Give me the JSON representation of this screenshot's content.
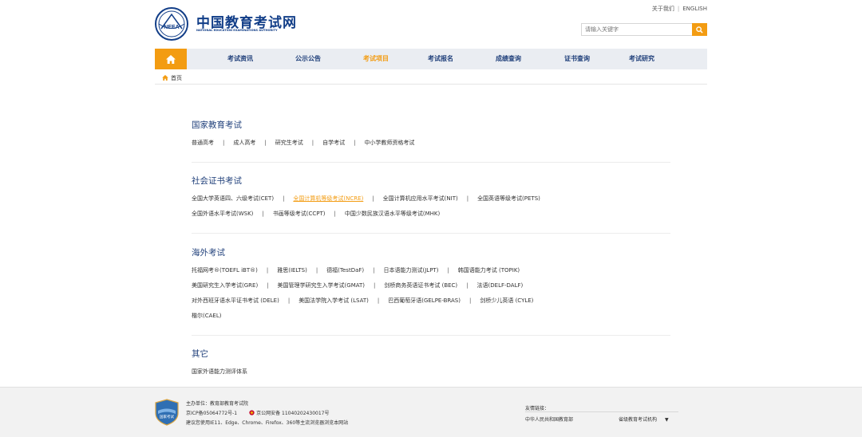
{
  "header": {
    "logo_cn": "中国教育考试网",
    "logo_en": "NATIONAL EDUCATION EXAMINATIONS AUTHORITY",
    "logo_badge": "NEEA",
    "toplinks": [
      "关于我们",
      "ENGLISH"
    ],
    "search_placeholder": "请输入关键字"
  },
  "nav": {
    "items": [
      "考试资讯",
      "公示公告",
      "考试项目",
      "考试报名",
      "成绩查询",
      "证书查询",
      "考试研究"
    ],
    "active_index": 2,
    "accent_color": "#f39c12",
    "bg_color": "#eaedf2"
  },
  "breadcrumb": {
    "home": "首页"
  },
  "sections": [
    {
      "title": "国家教育考试",
      "lines": [
        [
          "普通高考",
          "成人高考",
          "研究生考试",
          "自学考试",
          "中小学教师资格考试"
        ]
      ]
    },
    {
      "title": "社会证书考试",
      "lines": [
        [
          "全国大学英语四、六级考试(CET)",
          "全国计算机等级考试(NCRE)",
          "全国计算机应用水平考试(NIT)",
          "全国英语等级考试(PETS)"
        ],
        [
          "全国外语水平考试(WSK)",
          "书画等级考试(CCPT)",
          "中国少数民族汉语水平等级考试(MHK)"
        ]
      ],
      "highlight": "全国计算机等级考试(NCRE)"
    },
    {
      "title": "海外考试",
      "lines": [
        [
          "托福网考®(TOEFL iBT®)",
          "雅思(IELTS)",
          "德福(TestDaF)",
          "日本语能力测试(JLPT)",
          "韩国语能力考试 (TOPIK)"
        ],
        [
          "美国研究生入学考试(GRE)",
          "美国管理学研究生入学考试(GMAT)",
          "剑桥商务英语证书考试 (BEC)",
          "法语(DELF-DALF)"
        ],
        [
          "对外西班牙语水平证书考试 (DELE)",
          "美国法学院入学考试 (LSAT)",
          "巴西葡萄牙语(GELPE-BRAS)",
          "剑桥少儿英语 (CYLE)"
        ],
        [
          "楷尔(CAEL)"
        ]
      ]
    },
    {
      "title": "其它",
      "lines": [
        [
          "国家外语能力测评体系"
        ]
      ]
    }
  ],
  "footer": {
    "logo_text": "国家考试",
    "sponsor": "主办单位：教育部教育考试院",
    "icp": "京ICP备05064772号-1",
    "police": "京公网安备 11040202430017号",
    "browser_hint": "建议您使用IE11、Edge、Chrome、Firefox、360等主流浏览器浏览本网站",
    "links_label": "友情链接：",
    "link1": "中华人民共和国教育部",
    "link2": "省级教育考试机构"
  }
}
